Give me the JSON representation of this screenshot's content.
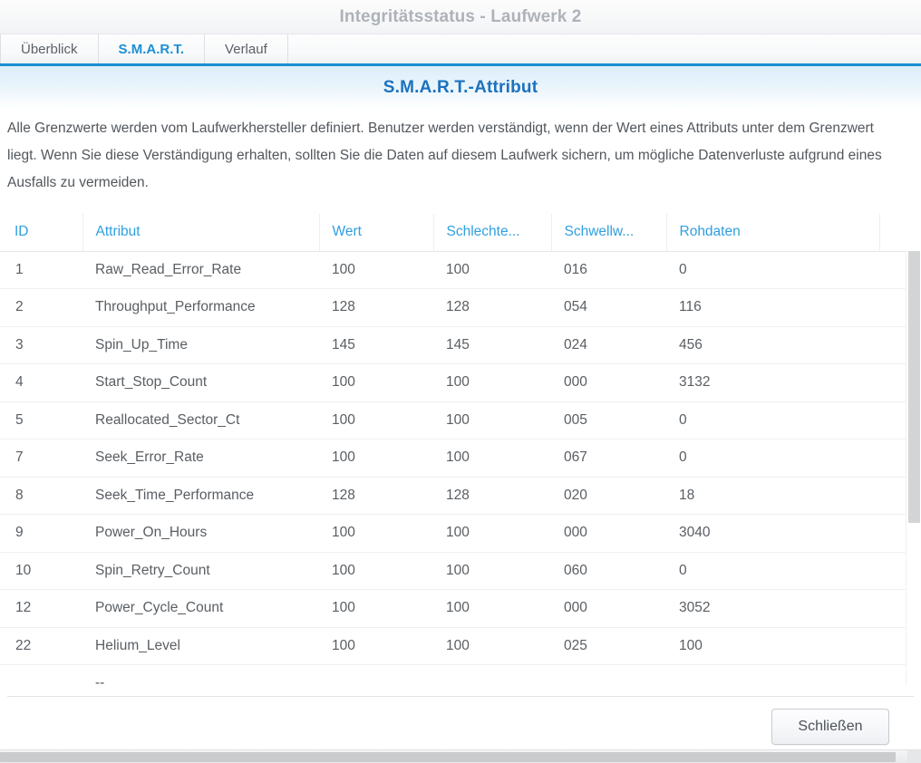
{
  "window": {
    "title": "Integritätsstatus - Laufwerk 2"
  },
  "tabs": [
    {
      "label": "Überblick",
      "active": false
    },
    {
      "label": "S.M.A.R.T.",
      "active": true
    },
    {
      "label": "Verlauf",
      "active": false
    }
  ],
  "section": {
    "heading": "S.M.A.R.T.-Attribut",
    "description": "Alle Grenzwerte werden vom Laufwerkhersteller definiert. Benutzer werden verständigt, wenn der Wert eines Attributs unter dem Grenzwert liegt. Wenn Sie diese Verständigung erhalten, sollten Sie die Daten auf diesem Laufwerk sichern, um mögliche Datenverluste aufgrund eines Ausfalls zu vermeiden."
  },
  "table": {
    "columns": [
      "ID",
      "Attribut",
      "Wert",
      "Schlechte...",
      "Schwellw...",
      "Rohdaten",
      ""
    ],
    "rows": [
      {
        "id": "1",
        "attribut": "Raw_Read_Error_Rate",
        "wert": "100",
        "schlechtester": "100",
        "schwellwert": "016",
        "rohdaten": "0"
      },
      {
        "id": "2",
        "attribut": "Throughput_Performance",
        "wert": "128",
        "schlechtester": "128",
        "schwellwert": "054",
        "rohdaten": "116"
      },
      {
        "id": "3",
        "attribut": "Spin_Up_Time",
        "wert": "145",
        "schlechtester": "145",
        "schwellwert": "024",
        "rohdaten": "456"
      },
      {
        "id": "4",
        "attribut": "Start_Stop_Count",
        "wert": "100",
        "schlechtester": "100",
        "schwellwert": "000",
        "rohdaten": "3132"
      },
      {
        "id": "5",
        "attribut": "Reallocated_Sector_Ct",
        "wert": "100",
        "schlechtester": "100",
        "schwellwert": "005",
        "rohdaten": "0"
      },
      {
        "id": "7",
        "attribut": "Seek_Error_Rate",
        "wert": "100",
        "schlechtester": "100",
        "schwellwert": "067",
        "rohdaten": "0"
      },
      {
        "id": "8",
        "attribut": "Seek_Time_Performance",
        "wert": "128",
        "schlechtester": "128",
        "schwellwert": "020",
        "rohdaten": "18"
      },
      {
        "id": "9",
        "attribut": "Power_On_Hours",
        "wert": "100",
        "schlechtester": "100",
        "schwellwert": "000",
        "rohdaten": "3040"
      },
      {
        "id": "10",
        "attribut": "Spin_Retry_Count",
        "wert": "100",
        "schlechtester": "100",
        "schwellwert": "060",
        "rohdaten": "0"
      },
      {
        "id": "12",
        "attribut": "Power_Cycle_Count",
        "wert": "100",
        "schlechtester": "100",
        "schwellwert": "000",
        "rohdaten": "3052"
      },
      {
        "id": "22",
        "attribut": "Helium_Level",
        "wert": "100",
        "schlechtester": "100",
        "schwellwert": "025",
        "rohdaten": "100"
      }
    ],
    "clipped_row": {
      "id": "",
      "attribut": "--",
      "wert": "",
      "schlechtester": "",
      "schwellwert": "",
      "rohdaten": ""
    }
  },
  "footer": {
    "close_label": "Schließen"
  },
  "colors": {
    "accent": "#1b8ed1",
    "heading": "#1b72bd",
    "column_header": "#2f9fe0",
    "tab_active": "#1a8fd4",
    "body_text": "#595e63",
    "title_text": "#aeb2b9"
  }
}
